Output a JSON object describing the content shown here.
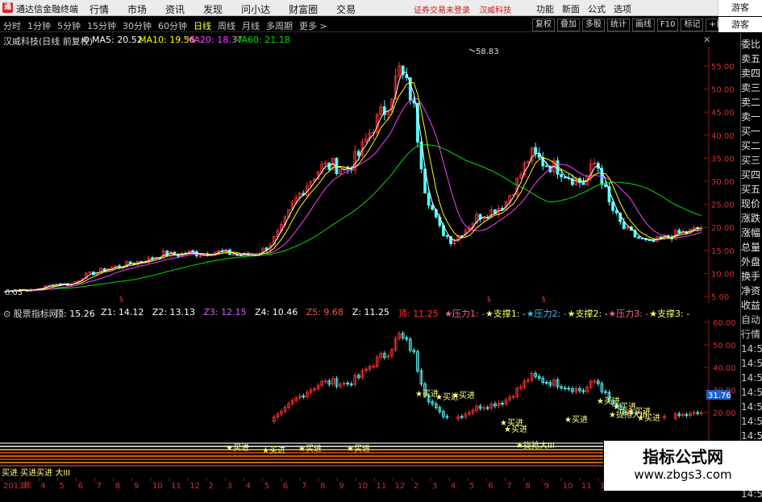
{
  "titlebar": {
    "app_title": "通达信金融终端",
    "logo_char": "通",
    "menu": [
      "行情",
      "市场",
      "资讯",
      "发现",
      "问小达",
      "财富圈",
      "交易"
    ],
    "notice": [
      "证券交易未登录",
      "汉威科技"
    ],
    "right_menu": [
      "功能",
      "新面",
      "公式",
      "选项"
    ],
    "guest": "游客"
  },
  "toolbar": {
    "periods": [
      "分时",
      "1分钟",
      "5分钟",
      "15分钟",
      "30分钟",
      "60分钟",
      "日线",
      "周线",
      "月线",
      "多周期",
      "更多 >"
    ],
    "active_period": "日线",
    "buttons": [
      "复权",
      "叠加",
      "多股",
      "统计",
      "画线",
      "F10",
      "标记",
      "+自选"
    ],
    "guest": "游客"
  },
  "main_header": {
    "stock": "汉威科技(日线 前复权)",
    "ma5": "MA5: 20.52",
    "ma10": "MA10: 19.56",
    "ma20": "MA20: 18.37",
    "ma60": "MA60: 21.18"
  },
  "price_axis": [
    "55.00",
    "50.00",
    "45.00",
    "40.00",
    "35.00",
    "30.00",
    "25.00",
    "20.00",
    "15.00",
    "10.00",
    "5.00"
  ],
  "price_labels": {
    "high": "58.83",
    "low": "6.05"
  },
  "sub_header": {
    "name": "股票指标网",
    "items": [
      {
        "t": "顶: 15.26",
        "c": "#ffffff"
      },
      {
        "t": "Z1: 14.12",
        "c": "#ffffff"
      },
      {
        "t": "Z2: 13.13",
        "c": "#ffffff"
      },
      {
        "t": "Z3: 12.15",
        "c": "#d060ff"
      },
      {
        "t": "Z4: 10.46",
        "c": "#ffffff"
      },
      {
        "t": "Z5: 9.68",
        "c": "#ff5050"
      },
      {
        "t": "Z: 11.25",
        "c": "#ffffff"
      },
      {
        "t": "顶: 11.25",
        "c": "#ff3030"
      },
      {
        "t": "★压力1: -",
        "c": "#ff6080"
      },
      {
        "t": "★支撑1: -",
        "c": "#ffff60"
      },
      {
        "t": "★压力2: -",
        "c": "#40c0ff"
      },
      {
        "t": "★支撑2: -",
        "c": "#ffff60"
      },
      {
        "t": "★压力3: -",
        "c": "#ff6080"
      },
      {
        "t": "★支撑3: -",
        "c": "#ffff60"
      }
    ]
  },
  "sub_axis": [
    "60.00",
    "50.00",
    "40.00",
    "30.00",
    "20.00"
  ],
  "sub_value": "31.76",
  "signals": [
    "买进",
    "买进",
    "买进",
    "买进",
    "买进",
    "买进",
    "买进",
    "买进",
    "买进",
    "拢抢大III",
    "买进",
    "买进",
    "拢抢大III",
    "买进",
    "买进",
    "买进"
  ],
  "bottom_signal": "买进 买进买进 大III",
  "side_panel": [
    "委比",
    "卖五",
    "卖四",
    "卖三",
    "卖二",
    "卖一",
    "买一",
    "买二",
    "买三",
    "买四",
    "买五",
    "现价",
    "涨跌",
    "涨幅",
    "总量",
    "外盘",
    "换手",
    "净资",
    "收益",
    "自动",
    "行情",
    "14:50",
    "14:50",
    "14:50",
    "14:50",
    "14:50",
    "14:50",
    "14:50",
    "14:50",
    "14:50",
    "14:50",
    "14:50"
  ],
  "date_axis": [
    "2013年",
    "3",
    "4",
    "5",
    "6",
    "7",
    "8",
    "9",
    "10",
    "11",
    "12",
    "2",
    "3",
    "4",
    "5",
    "6",
    "7",
    "8",
    "9",
    "10",
    "11",
    "12",
    "2",
    "3",
    "4",
    "5",
    "6",
    "7",
    "8",
    "9",
    "10",
    "11",
    "12"
  ],
  "watermark": {
    "line1": "指标公式网",
    "line2": "www.zbgs3.com"
  },
  "colors": {
    "up": "#ff3232",
    "down": "#54ffff",
    "ma5": "#ffffff",
    "ma10": "#ffff00",
    "ma20": "#ff40ff",
    "ma60": "#00e000"
  },
  "chart_data": {
    "type": "line",
    "series": [
      {
        "name": "收盘",
        "values": [
          6.1,
          6.6,
          6.3,
          7.1,
          7.8,
          7.6,
          9.5,
          10.3,
          11.2,
          11.8,
          12.5,
          13.1,
          14.3,
          14.0,
          14.6,
          14.2,
          14.8,
          14.4,
          13.9,
          14.1,
          15.8,
          19.5,
          25.5,
          29.5,
          33.0,
          33.5,
          32.6,
          36.0,
          42.0,
          46.0,
          54.0,
          48.0,
          28.0,
          20.0,
          17.0,
          19.5,
          22.5,
          23.5,
          25.0,
          30.0,
          36.0,
          34.0,
          33.0,
          31.0,
          29.5,
          34.5,
          25.0,
          20.0,
          18.0,
          16.5,
          17.5,
          18.5,
          19.0,
          20.0
        ]
      }
    ],
    "ylim": [
      5,
      60
    ]
  }
}
